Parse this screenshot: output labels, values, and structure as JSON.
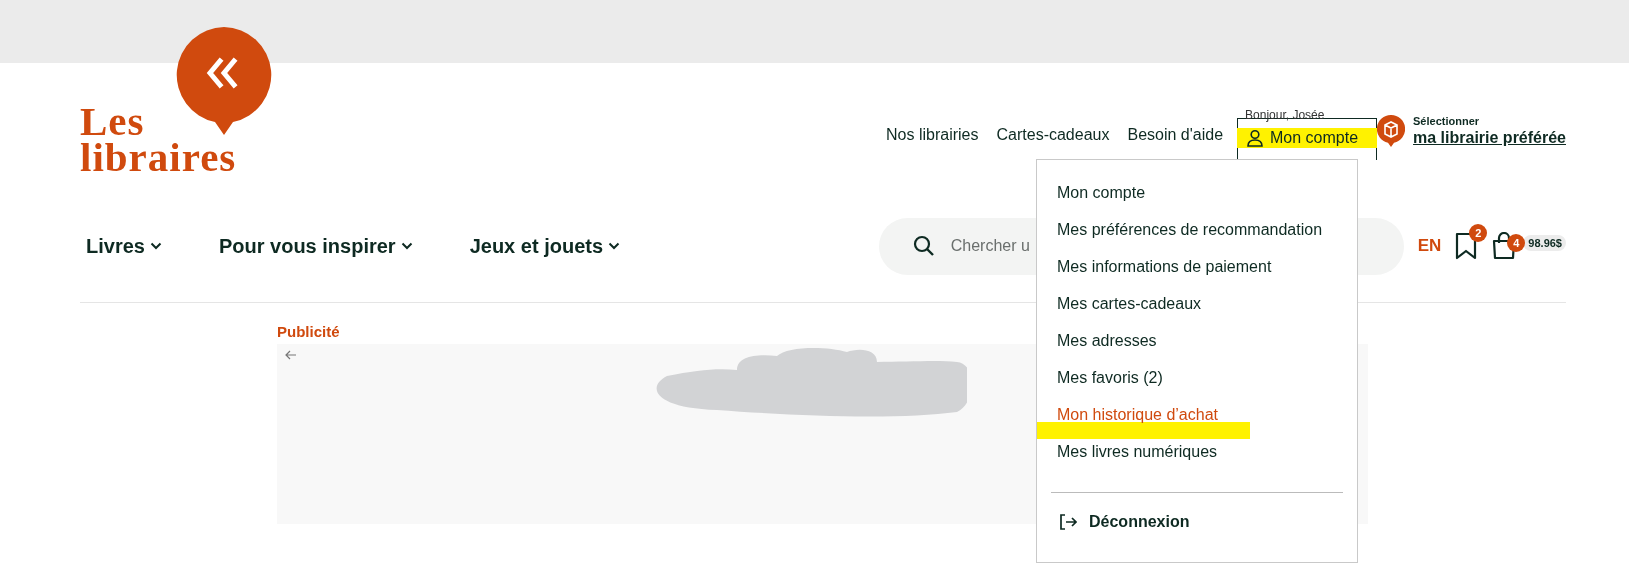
{
  "logo": {
    "line_1": "Les",
    "line_2": "libraires"
  },
  "top_links": [
    "Nos librairies",
    "Cartes-cadeaux",
    "Besoin d'aide"
  ],
  "account": {
    "greeting": "Bonjour, Josée",
    "label": "Mon compte"
  },
  "library": {
    "caption": "Sélectionner",
    "link": "ma librairie préférée"
  },
  "nav": [
    "Livres",
    "Pour vous inspirer",
    "Jeux et jouets"
  ],
  "search": {
    "placeholder": "Chercher u"
  },
  "language": "EN",
  "bookmarks": {
    "count": "2"
  },
  "cart": {
    "count": "4",
    "total": "98.96$"
  },
  "ad": {
    "label": "Publicité"
  },
  "account_menu": {
    "items": [
      {
        "label": "Mon compte",
        "selected": false
      },
      {
        "label": "Mes préférences de recommandation",
        "selected": false
      },
      {
        "label": "Mes informations de paiement",
        "selected": false
      },
      {
        "label": "Mes cartes-cadeaux",
        "selected": false
      },
      {
        "label": "Mes adresses",
        "selected": false
      },
      {
        "label": "Mes favoris (2)",
        "selected": false
      },
      {
        "label": "Mon historique d’achat",
        "selected": true
      },
      {
        "label": "Mes livres numériques",
        "selected": false
      }
    ],
    "logout": "Déconnexion"
  }
}
